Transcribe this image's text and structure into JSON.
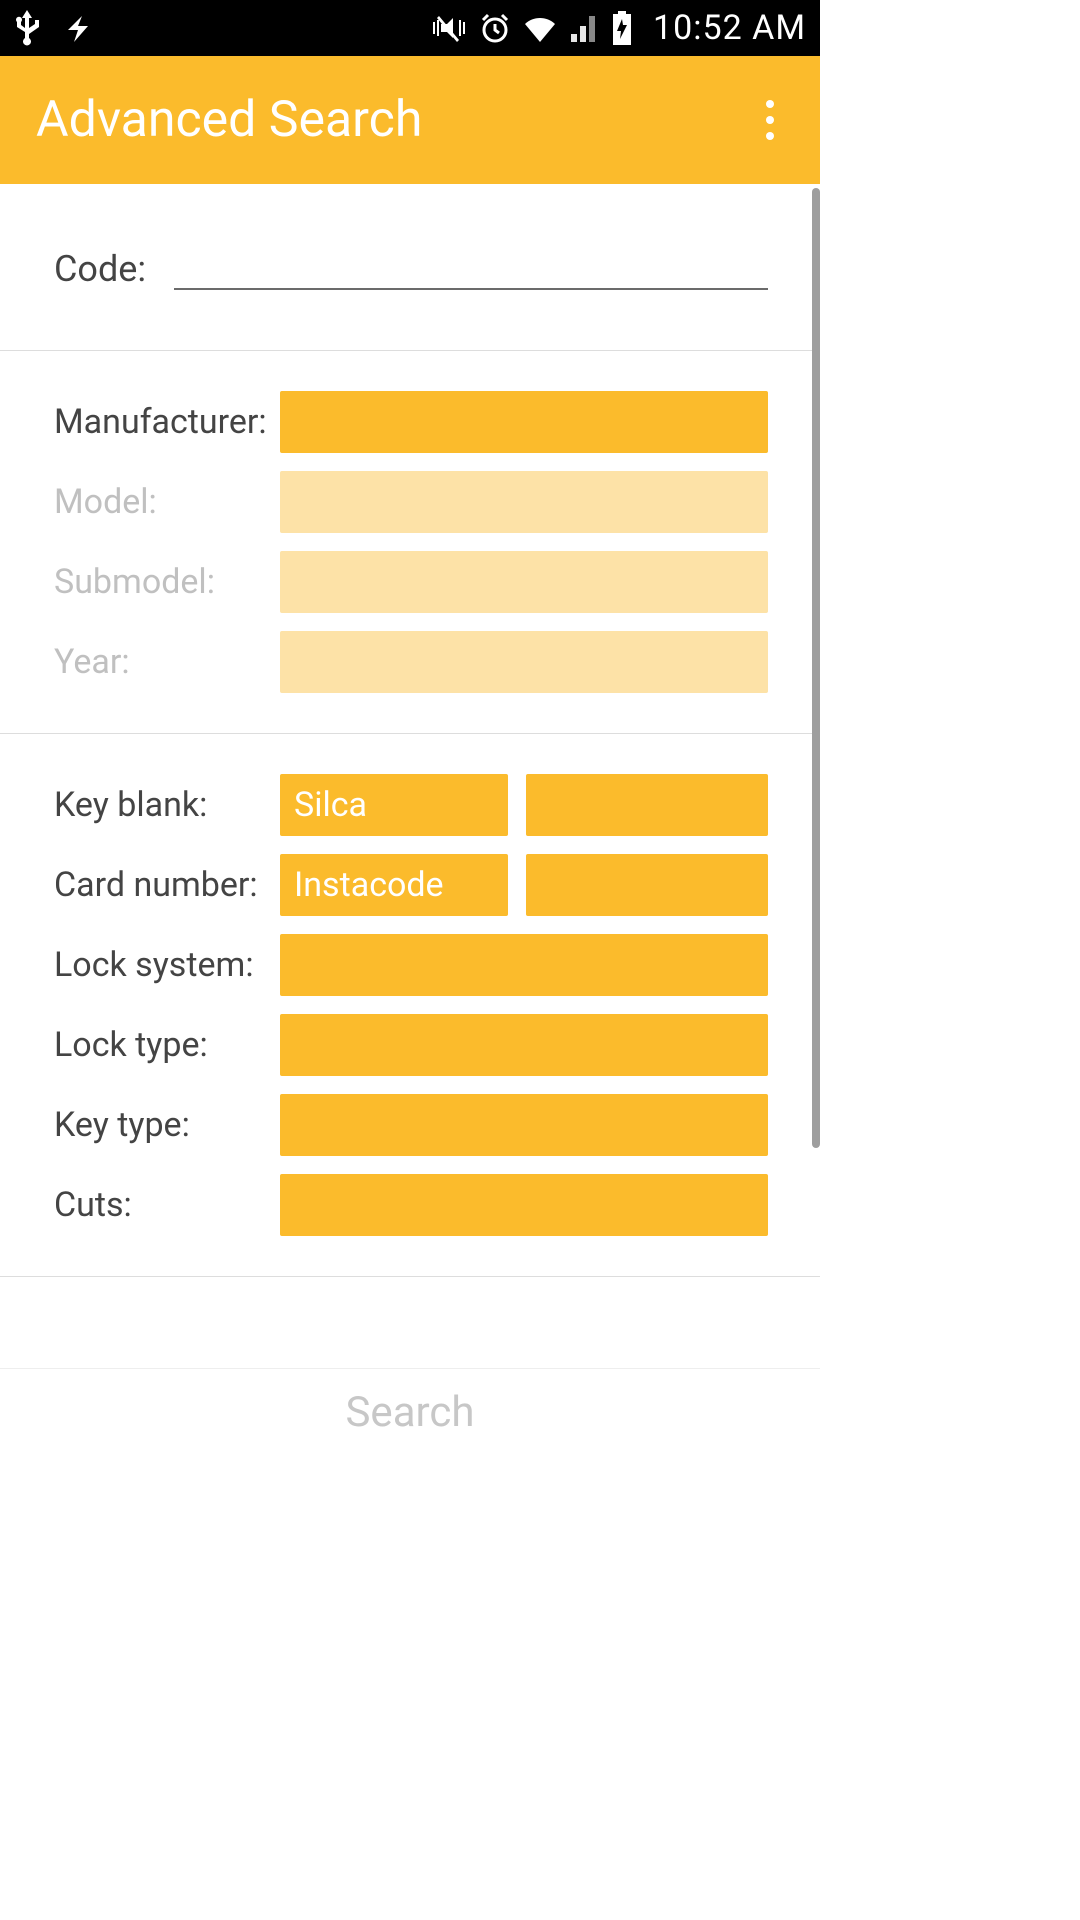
{
  "status": {
    "time": "10:52 AM"
  },
  "appbar": {
    "title": "Advanced Search"
  },
  "colors": {
    "accent": "#FBBB2C",
    "accent_disabled": "#FDE2A7"
  },
  "section_code": {
    "label": "Code:",
    "value": ""
  },
  "section_vehicle": {
    "rows": [
      {
        "label": "Manufacturer:",
        "value": "",
        "disabled": false
      },
      {
        "label": "Model:",
        "value": "",
        "disabled": true
      },
      {
        "label": "Submodel:",
        "value": "",
        "disabled": true
      },
      {
        "label": "Year:",
        "value": "",
        "disabled": true
      }
    ]
  },
  "section_key": {
    "key_blank": {
      "label": "Key blank:",
      "select_a": "Silca",
      "select_b": ""
    },
    "card_number": {
      "label": "Card number:",
      "select_a": "Instacode",
      "select_b": ""
    },
    "lock_system": {
      "label": "Lock system:",
      "value": ""
    },
    "lock_type": {
      "label": "Lock type:",
      "value": ""
    },
    "key_type": {
      "label": "Key type:",
      "value": ""
    },
    "cuts": {
      "label": "Cuts:",
      "value": ""
    }
  },
  "footer": {
    "search_label": "Search"
  }
}
